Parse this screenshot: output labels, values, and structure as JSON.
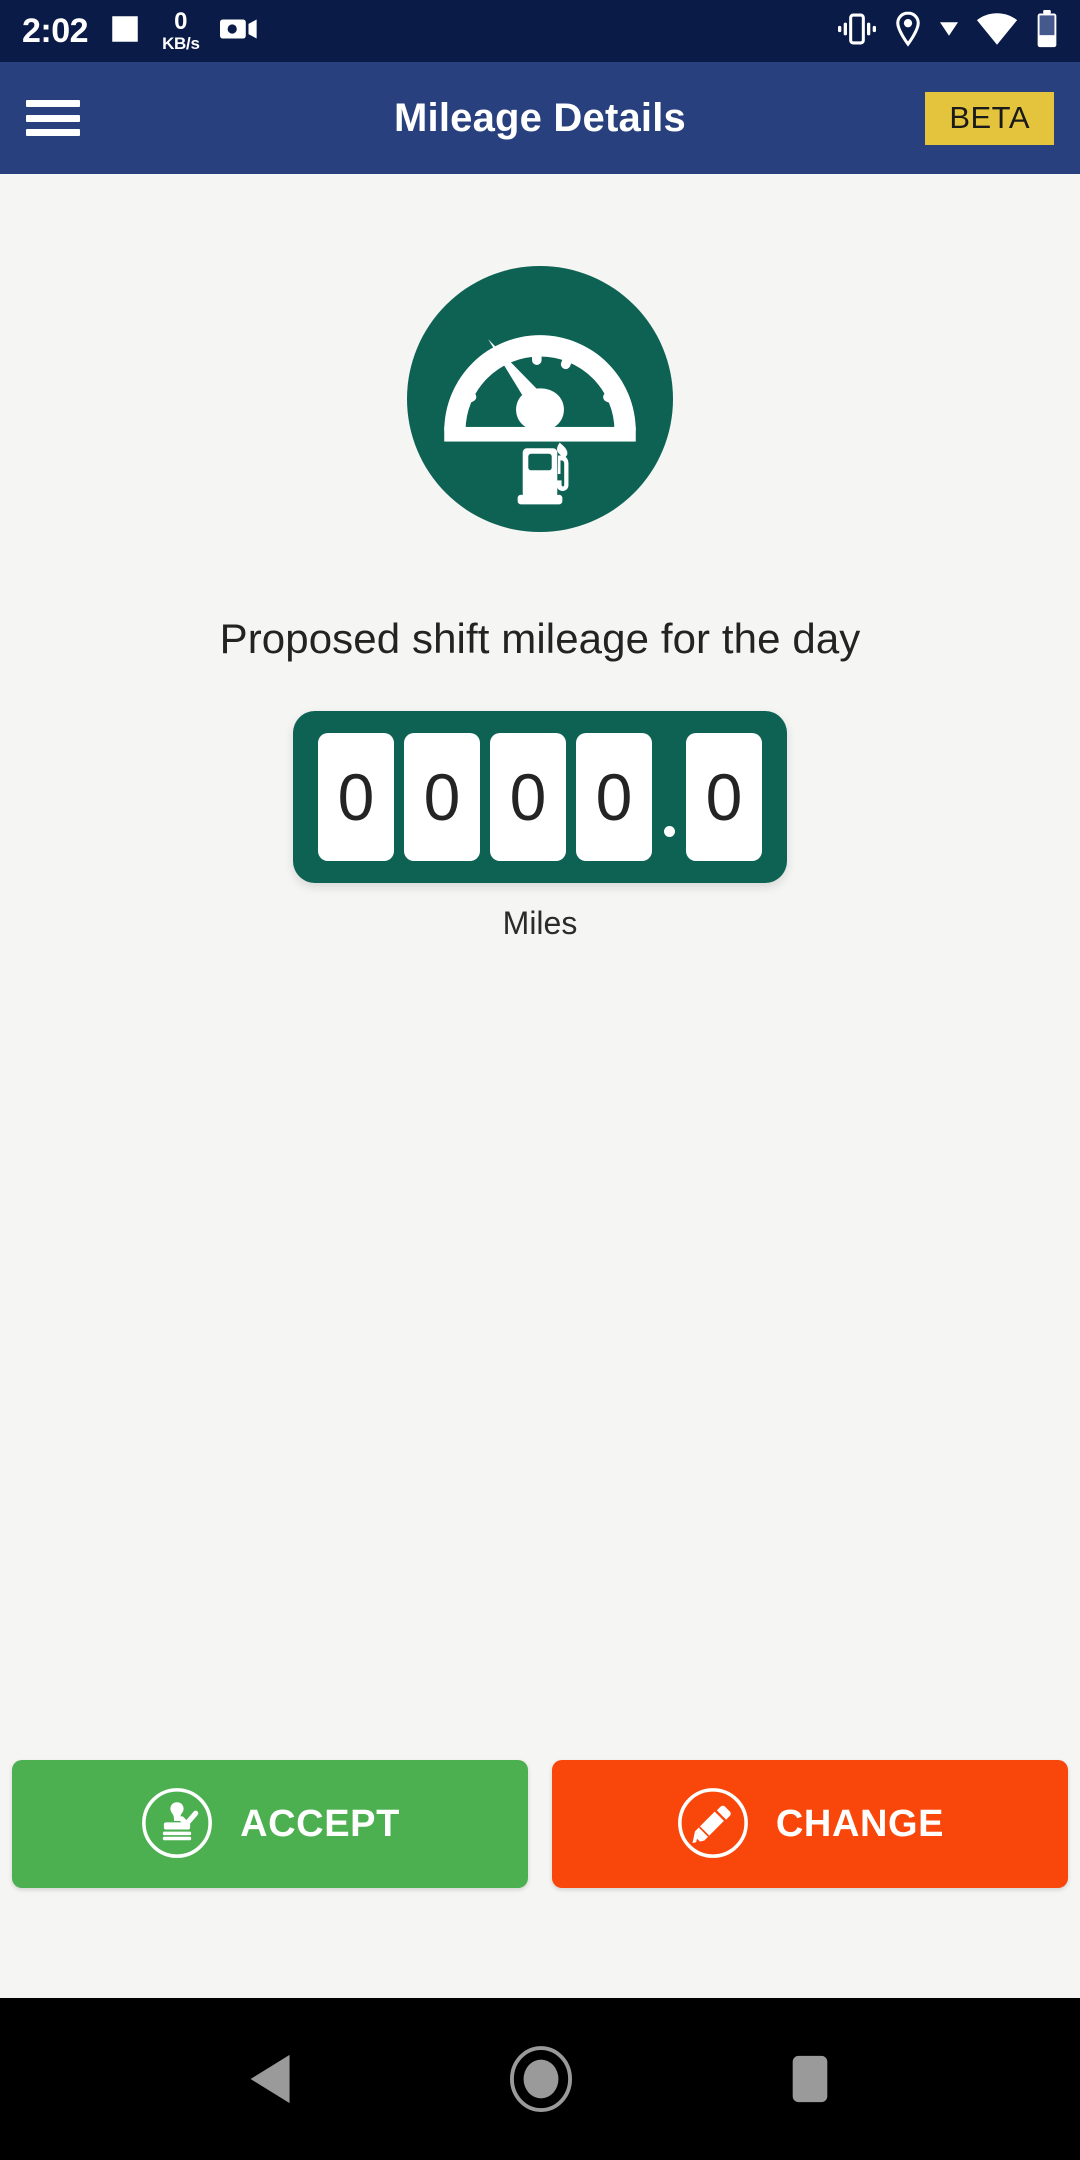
{
  "status_bar": {
    "time": "2:02",
    "network_speed_value": "0",
    "network_speed_unit": "KB/s",
    "left_icons": [
      "image-icon",
      "video-camera-icon"
    ],
    "right_icons": [
      "vibrate-icon",
      "location-pin-icon",
      "dropdown-triangle-icon",
      "wifi-icon",
      "battery-icon"
    ],
    "background_color": "#0B1B47"
  },
  "app_bar": {
    "menu_icon": "hamburger-menu-icon",
    "title": "Mileage Details",
    "badge_label": "BETA",
    "background_color": "#29407E",
    "badge_color": "#E3C43C"
  },
  "main": {
    "hero_icon": "speedometer-fuel-icon",
    "hero_icon_color": "#0D6254",
    "caption": "Proposed shift mileage for the day",
    "odometer": {
      "digits": [
        "0",
        "0",
        "0",
        "0"
      ],
      "decimal_separator": ".",
      "decimal_digits": [
        "0"
      ],
      "value": "0000.0",
      "unit_label": "Miles",
      "frame_color": "#0D6254",
      "digit_background": "#FFFFFF"
    }
  },
  "actions": {
    "accept": {
      "label": "ACCEPT",
      "icon": "stamp-approve-icon",
      "color": "#4CAF50"
    },
    "change": {
      "label": "CHANGE",
      "icon": "pencil-edit-icon",
      "color": "#F9470B"
    }
  },
  "nav_bar": {
    "back": "back-triangle-icon",
    "home": "home-circle-icon",
    "recents": "recents-square-icon",
    "background_color": "#000000"
  }
}
